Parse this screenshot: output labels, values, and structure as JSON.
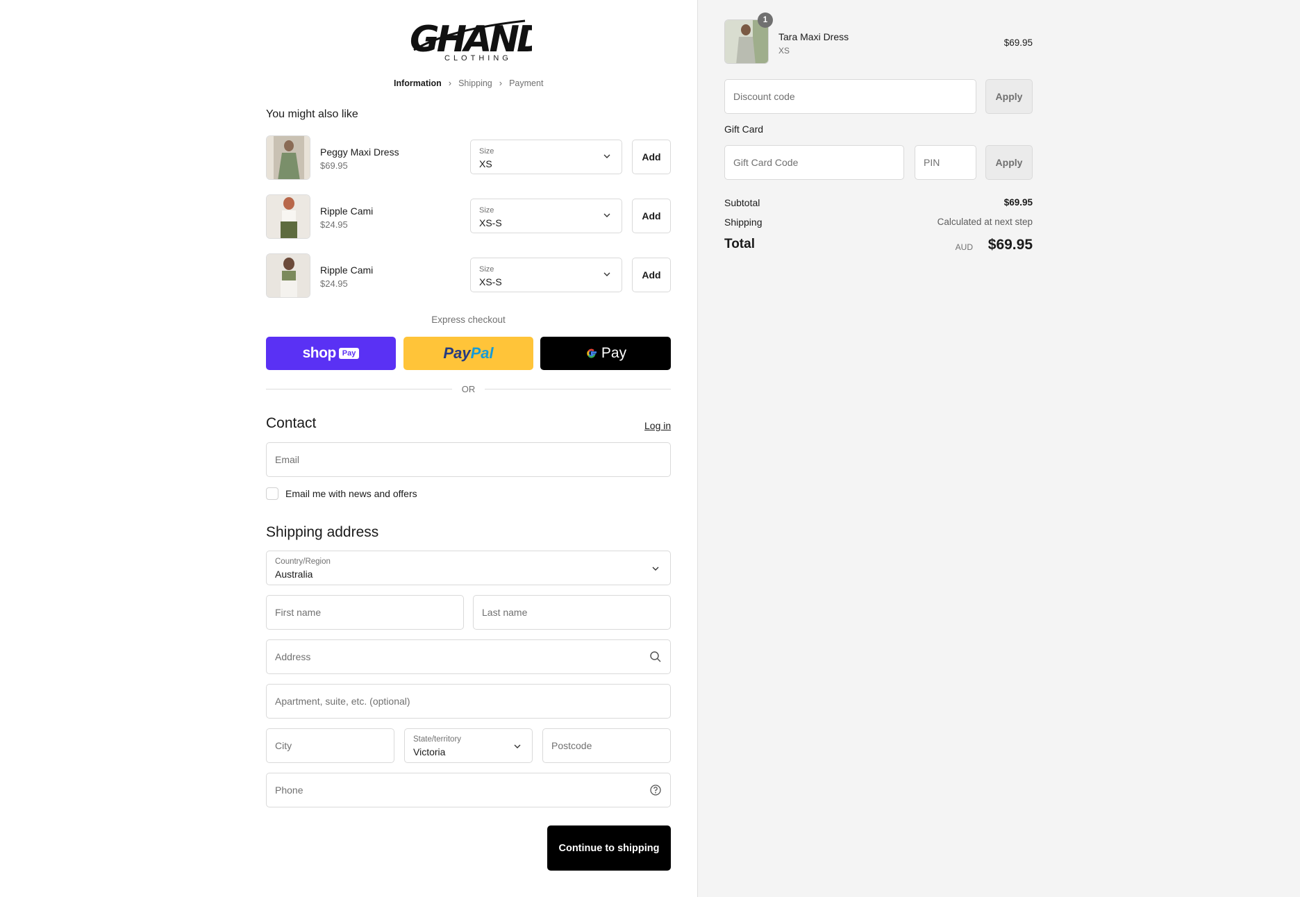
{
  "brand": {
    "name": "GHANDA",
    "sub": "CLOTHING"
  },
  "breadcrumb": [
    "Information",
    "Shipping",
    "Payment"
  ],
  "upsell": {
    "title": "You might also like",
    "items": [
      {
        "name": "Peggy Maxi Dress",
        "price": "$69.95",
        "size_label": "Size",
        "size": "XS",
        "add": "Add"
      },
      {
        "name": "Ripple Cami",
        "price": "$24.95",
        "size_label": "Size",
        "size": "XS-S",
        "add": "Add"
      },
      {
        "name": "Ripple Cami",
        "price": "$24.95",
        "size_label": "Size",
        "size": "XS-S",
        "add": "Add"
      }
    ]
  },
  "express": {
    "label": "Express checkout",
    "shop_pay": "shop",
    "shop_pay_badge": "Pay",
    "paypal_a": "Pay",
    "paypal_b": "Pal",
    "gpay": "Pay",
    "or": "OR"
  },
  "contact": {
    "title": "Contact",
    "login": "Log in",
    "email_placeholder": "Email",
    "news_checkbox": "Email me with news and offers"
  },
  "shipping": {
    "title": "Shipping address",
    "country_label": "Country/Region",
    "country": "Australia",
    "first_name": "First name",
    "last_name": "Last name",
    "address": "Address",
    "apartment": "Apartment, suite, etc. (optional)",
    "city": "City",
    "state_label": "State/territory",
    "state": "Victoria",
    "postcode": "Postcode",
    "phone": "Phone",
    "continue": "Continue to shipping"
  },
  "cart": {
    "item": {
      "name": "Tara Maxi Dress",
      "variant": "XS",
      "price": "$69.95",
      "quantity": "1"
    },
    "discount_placeholder": "Discount code",
    "apply": "Apply",
    "gift_card_label": "Gift Card",
    "gift_card_placeholder": "Gift Card Code",
    "pin_placeholder": "PIN",
    "subtotal_label": "Subtotal",
    "subtotal": "$69.95",
    "shipping_label": "Shipping",
    "shipping_value": "Calculated at next step",
    "total_label": "Total",
    "currency": "AUD",
    "total": "$69.95"
  },
  "colors": {
    "shop_pay": "#5a31f4",
    "paypal": "#ffc439",
    "gpay": "#000000",
    "primary_button": "#000000"
  }
}
